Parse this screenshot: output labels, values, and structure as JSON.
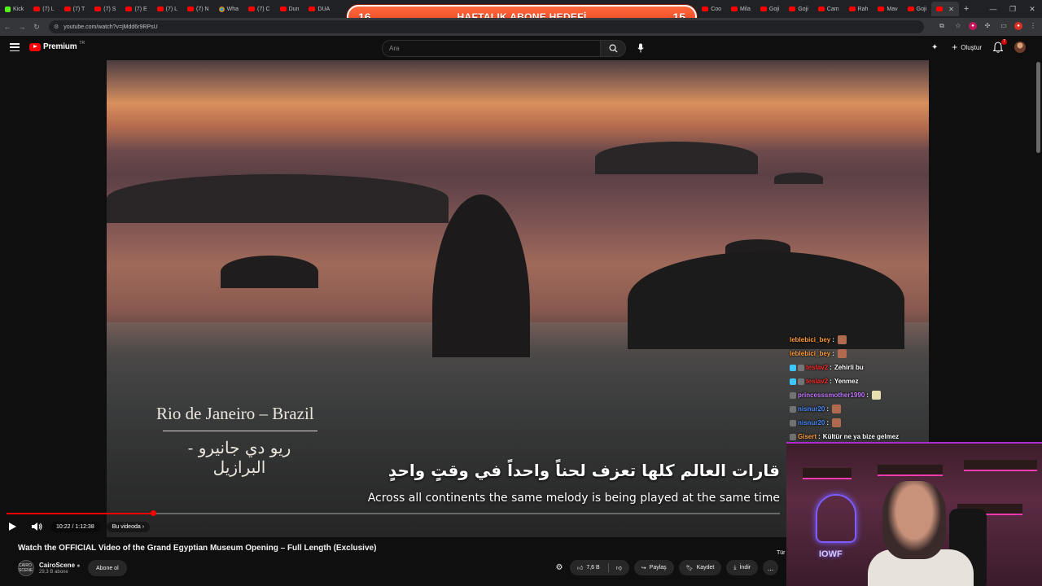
{
  "browser": {
    "tabs": [
      {
        "label": "Kick",
        "fav": "green"
      },
      {
        "label": "(7) L",
        "fav": "yt"
      },
      {
        "label": "(7) T",
        "fav": "yt"
      },
      {
        "label": "(7) S",
        "fav": "yt"
      },
      {
        "label": "(7) E",
        "fav": "yt"
      },
      {
        "label": "(7) L",
        "fav": "yt"
      },
      {
        "label": "(7) N",
        "fav": "yt"
      },
      {
        "label": "Wha",
        "fav": "chrome"
      },
      {
        "label": "(7) C",
        "fav": "yt"
      },
      {
        "label": "Dun",
        "fav": "yt"
      },
      {
        "label": "DUA",
        "fav": "yt"
      }
    ],
    "tabs_right": [
      {
        "label": "Coo",
        "fav": "yt"
      },
      {
        "label": "Mila",
        "fav": "yt"
      },
      {
        "label": "Goji",
        "fav": "yt"
      },
      {
        "label": "Goji",
        "fav": "yt"
      },
      {
        "label": "Cam",
        "fav": "yt"
      },
      {
        "label": "Rah",
        "fav": "yt"
      },
      {
        "label": "Mav",
        "fav": "yt"
      },
      {
        "label": "Goji",
        "fav": "yt"
      }
    ],
    "url": "youtube.com/watch?v=jMdd6r9RPsU"
  },
  "goal_overlay": {
    "left_num": "16",
    "title": "HAFTALIK ABONE HEDEFİ",
    "right_num": "15"
  },
  "masthead": {
    "logo_word": "Premium",
    "region": "TR",
    "search_placeholder": "Ara",
    "create_label": "Oluştur",
    "notif_count": "7"
  },
  "video": {
    "place_en": "Rio de Janeiro – Brazil",
    "place_ar": "ريو دي جانيرو - البرازيل",
    "subtitle_ar": "قارات العالم كلها تعزف لحناً واحداً في وقتٍ واحدٍ",
    "subtitle_en": "Across all continents the same melody is being played at the same time",
    "progress": 0.1895,
    "time": "10:22 / 1:12:38",
    "chapter": "Bu videoda"
  },
  "chat": [
    {
      "user": "leblebici_bey",
      "color": "#ff9f3a",
      "badge": "",
      "text": "",
      "emote": "brown"
    },
    {
      "user": "leblebici_bey",
      "color": "#ff9f3a",
      "badge": "",
      "text": "",
      "emote": "brown"
    },
    {
      "user": "teslav2",
      "color": "#ff2d2d",
      "badge": "#3ec6ff",
      "text": "Zehirli bu",
      "emote": ""
    },
    {
      "user": "teslav2",
      "color": "#ff2d2d",
      "badge": "#3ec6ff",
      "text": "Yenmez",
      "emote": ""
    },
    {
      "user": "princesssmother1990",
      "color": "#c47bff",
      "badge": "",
      "text": "",
      "emote": "yellow"
    },
    {
      "user": "nisnur20",
      "color": "#4a8cff",
      "badge": "",
      "text": "",
      "emote": "brown"
    },
    {
      "user": "nisnur20",
      "color": "#4a8cff",
      "badge": "",
      "text": "",
      "emote": "brown"
    },
    {
      "user": "Gisert",
      "color": "#ff9f3a",
      "badge": "",
      "text": "Kültür ne ya bize gelmez",
      "emote": ""
    }
  ],
  "webcam": {
    "neon_text": "IOWF"
  },
  "details": {
    "title": "Watch the OFFICIAL Video of the Grand Egyptian Museum Opening – Full Length (Exclusive)",
    "channel": "CairoScene",
    "channel_avatar": "CAIRO SCENE",
    "subs": "29,3 B abone",
    "subscribe": "Abone ol",
    "likes": "7,6 B",
    "share": "Paylaş",
    "save": "Kaydet",
    "download": "İndir",
    "more": "...",
    "lang_peek": "Tür"
  }
}
